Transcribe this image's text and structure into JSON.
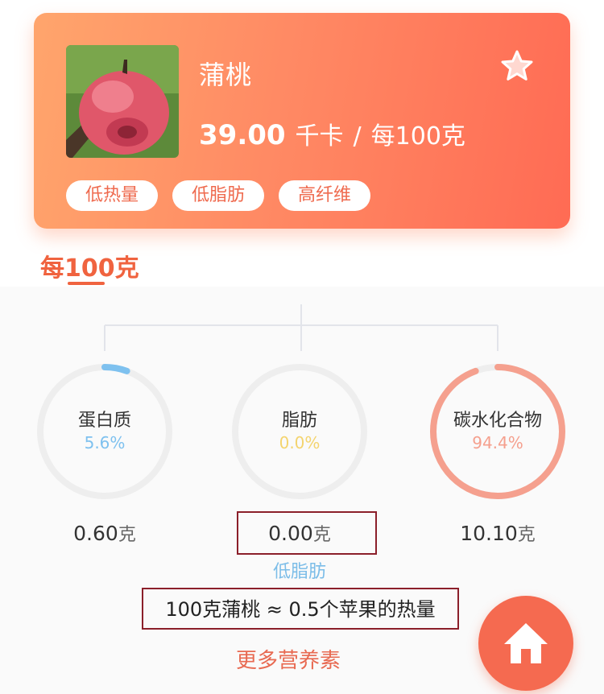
{
  "food": {
    "name": "蒲桃",
    "calories_value": "39.00",
    "calories_unit": "千卡",
    "separator": "/",
    "per_unit": "每100克",
    "tags": [
      "低热量",
      "低脂肪",
      "高纤维"
    ]
  },
  "tab": {
    "label": "每100克"
  },
  "nutrients": [
    {
      "name": "蛋白质",
      "percent_text": "5.6%",
      "percent": 5.6,
      "amount": "0.60",
      "unit": "克",
      "color": "#7ec1ef"
    },
    {
      "name": "脂肪",
      "percent_text": "0.0%",
      "percent": 0.0,
      "amount": "0.00",
      "unit": "克",
      "color": "#f4d46e"
    },
    {
      "name": "碳水化合物",
      "percent_text": "94.4%",
      "percent": 94.4,
      "amount": "10.10",
      "unit": "克",
      "color": "#f5a08e"
    }
  ],
  "fat_note": "低脂肪",
  "comparison": "100克蒲桃 ≈ 0.5个苹果的热量",
  "more_button": "更多营养素",
  "icons": {
    "favorite": "star-icon",
    "home": "home-icon"
  },
  "colors": {
    "accent": "#f0633f",
    "ring_track": "#eeeeee"
  }
}
